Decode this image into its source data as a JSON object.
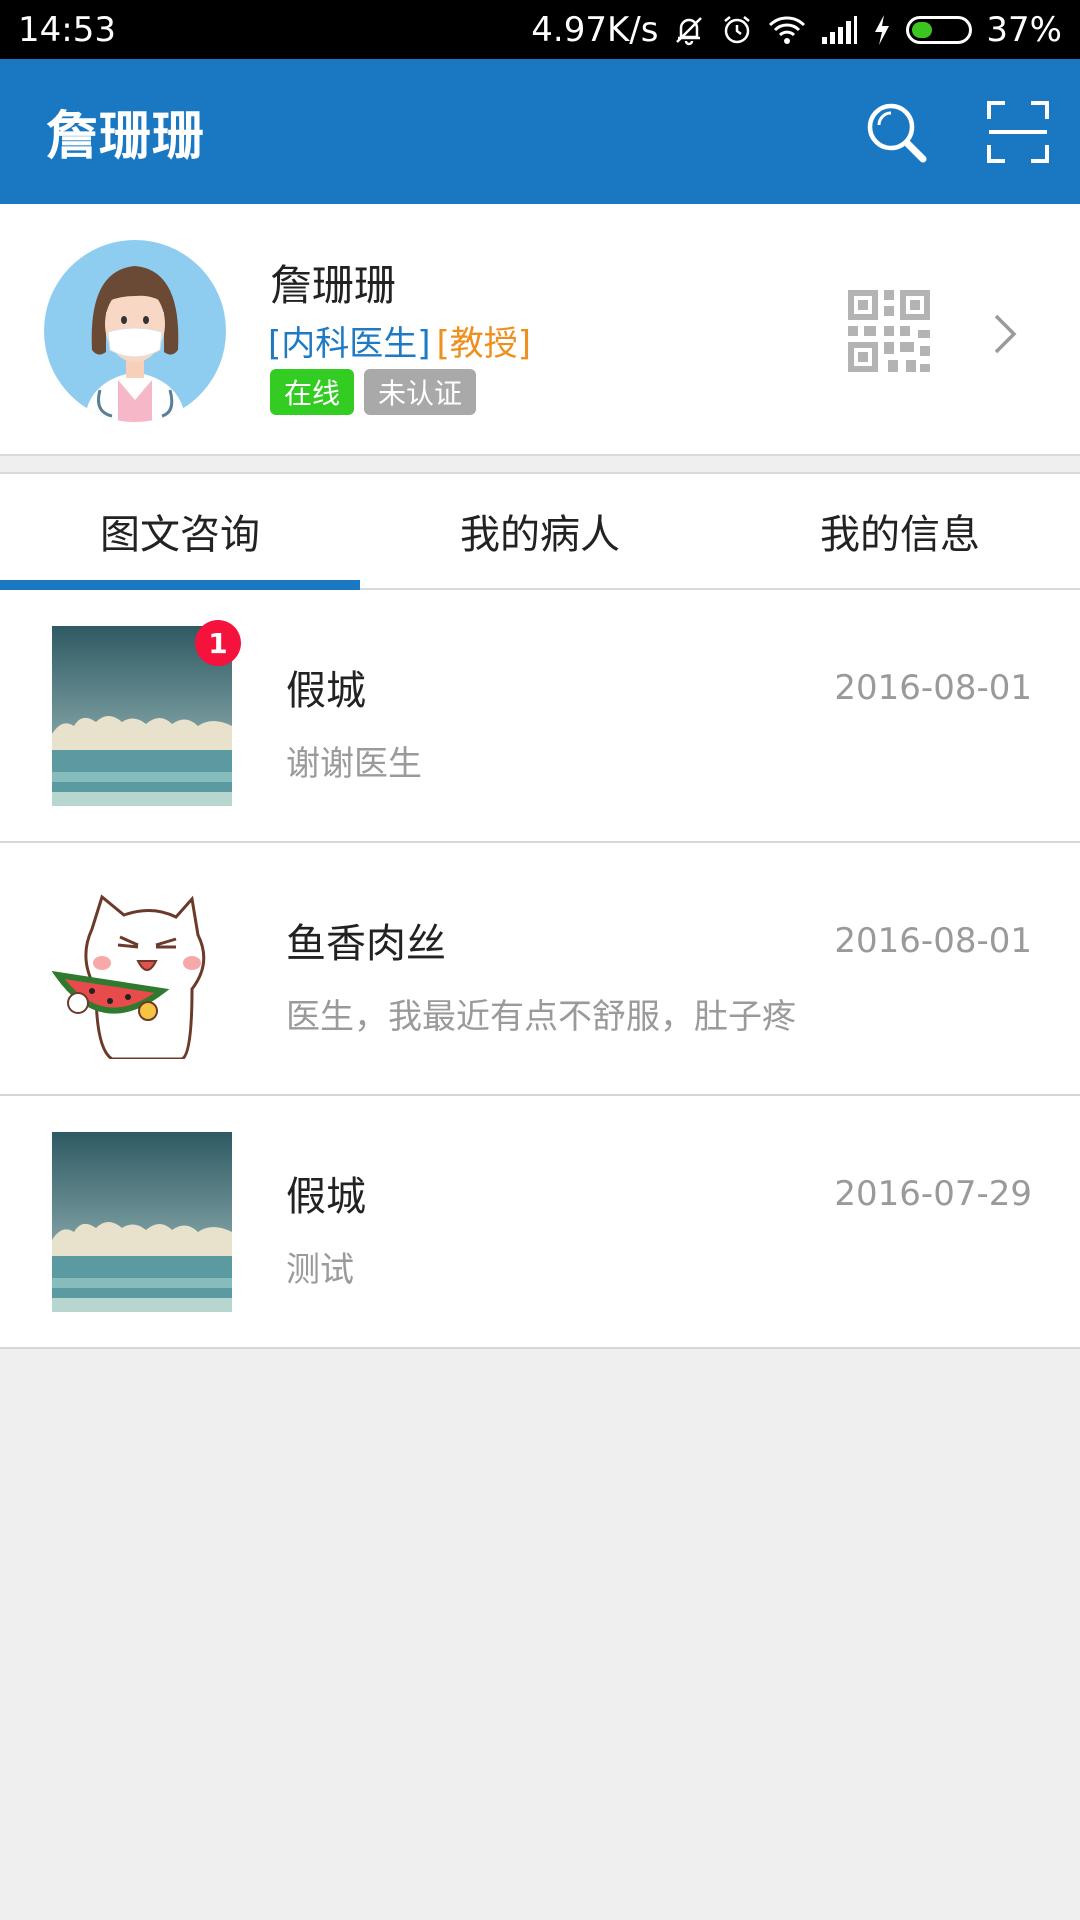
{
  "status_bar": {
    "time": "14:53",
    "net_speed": "4.97K/s",
    "battery": "37%",
    "battery_level": 0.37,
    "icons": [
      "mute-icon",
      "alarm-icon",
      "wifi-icon",
      "signal-icon",
      "charging-icon",
      "battery-icon"
    ]
  },
  "app_bar": {
    "title": "詹珊珊",
    "actions": [
      "search-icon",
      "scan-icon"
    ]
  },
  "profile": {
    "name": "詹珊珊",
    "department": "[内科医生]",
    "title": "[教授]",
    "status_badge": "在线",
    "verify_badge": "未认证",
    "colors": {
      "department": "#1f7ac4",
      "title": "#ef8f1e",
      "online": "#33cc22",
      "unverified": "#a9a9a9"
    }
  },
  "tabs": [
    {
      "label": "图文咨询",
      "active": true
    },
    {
      "label": "我的病人",
      "active": false
    },
    {
      "label": "我的信息",
      "active": false
    }
  ],
  "conversations": [
    {
      "name": "假城",
      "date": "2016-08-01",
      "message": "谢谢医生",
      "unread": "1",
      "avatar": "sea-photo"
    },
    {
      "name": "鱼香肉丝",
      "date": "2016-08-01",
      "message": "医生，我最近有点不舒服，肚子疼",
      "avatar": "cat-watermelon-sticker"
    },
    {
      "name": "假城",
      "date": "2016-07-29",
      "message": "测试",
      "avatar": "sea-photo"
    }
  ],
  "theme": {
    "primary": "#1a78c2",
    "unread_badge": "#f5123c"
  }
}
